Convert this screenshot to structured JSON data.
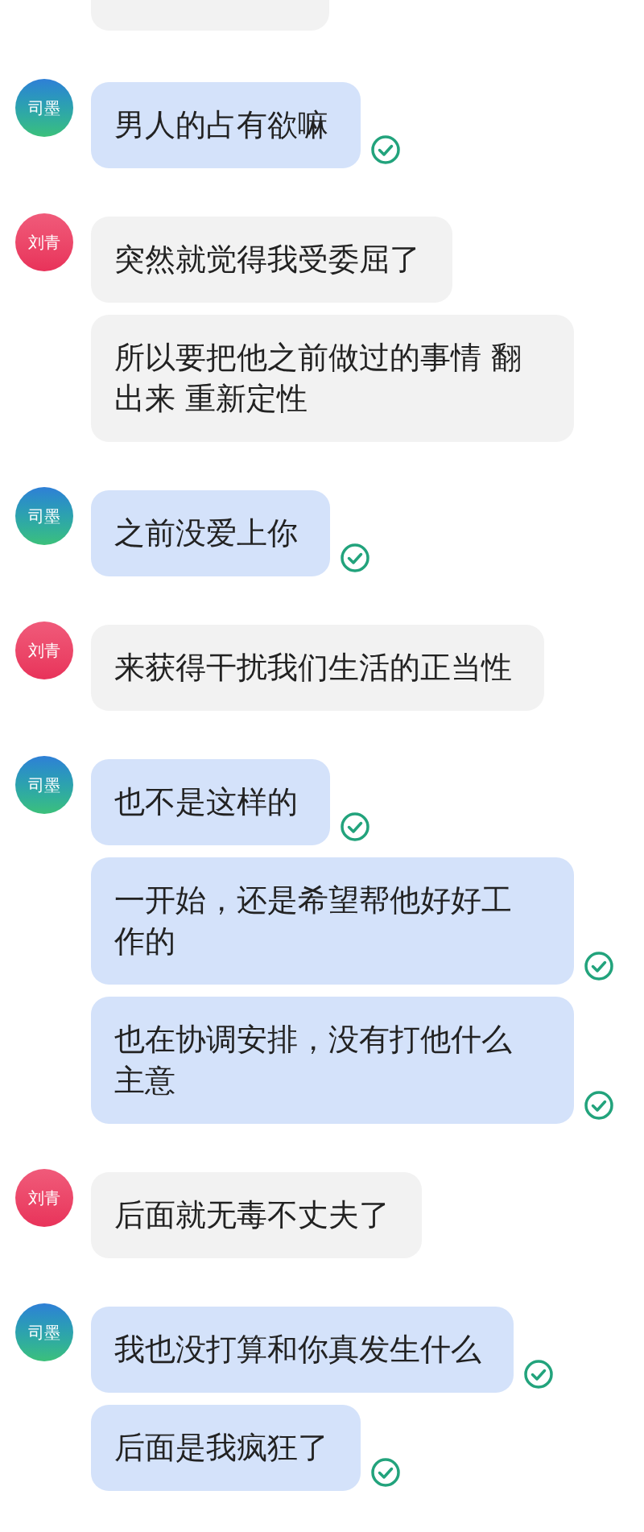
{
  "top_partial_bubble": {
    "kind": "other"
  },
  "groups": [
    {
      "kind": "self",
      "avatar_label": "司墨",
      "messages": [
        {
          "text": "男人的占有欲嘛",
          "read": true
        }
      ]
    },
    {
      "kind": "other",
      "avatar_label": "刘青",
      "messages": [
        {
          "text": "突然就觉得我受委屈了",
          "read": false
        },
        {
          "text": "所以要把他之前做过的事情 翻出来 重新定性",
          "read": false
        }
      ]
    },
    {
      "kind": "self",
      "avatar_label": "司墨",
      "messages": [
        {
          "text": "之前没爱上你",
          "read": true
        }
      ]
    },
    {
      "kind": "other",
      "avatar_label": "刘青",
      "messages": [
        {
          "text": "来获得干扰我们生活的正当性",
          "read": false
        }
      ]
    },
    {
      "kind": "self",
      "avatar_label": "司墨",
      "messages": [
        {
          "text": "也不是这样的",
          "read": true
        },
        {
          "text": "一开始，还是希望帮他好好工作的",
          "read": true
        },
        {
          "text": "也在协调安排，没有打他什么主意",
          "read": true
        }
      ]
    },
    {
      "kind": "other",
      "avatar_label": "刘青",
      "messages": [
        {
          "text": "后面就无毒不丈夫了",
          "read": false
        }
      ]
    },
    {
      "kind": "self",
      "avatar_label": "司墨",
      "messages": [
        {
          "text": "我也没打算和你真发生什么",
          "read": true
        },
        {
          "text": "后面是我疯狂了",
          "read": true
        }
      ]
    }
  ]
}
